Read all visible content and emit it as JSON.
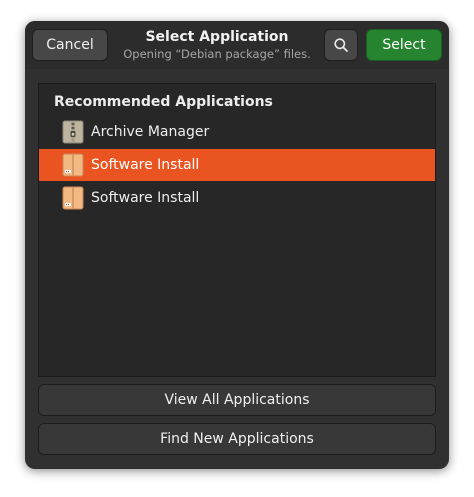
{
  "header": {
    "cancel_label": "Cancel",
    "title": "Select Application",
    "subtitle": "Opening “Debian package” files.",
    "search_icon": "search-icon",
    "select_label": "Select"
  },
  "list": {
    "heading": "Recommended Applications",
    "items": [
      {
        "label": "Archive Manager",
        "icon": "archive-manager-icon",
        "selected": false
      },
      {
        "label": "Software Install",
        "icon": "package-icon",
        "selected": true
      },
      {
        "label": "Software Install",
        "icon": "package-icon",
        "selected": false
      }
    ]
  },
  "footer": {
    "view_all_label": "View All Applications",
    "find_new_label": "Find New Applications"
  },
  "colors": {
    "accent": "#e95420",
    "select_button": "#26832f",
    "background": "#303030"
  }
}
